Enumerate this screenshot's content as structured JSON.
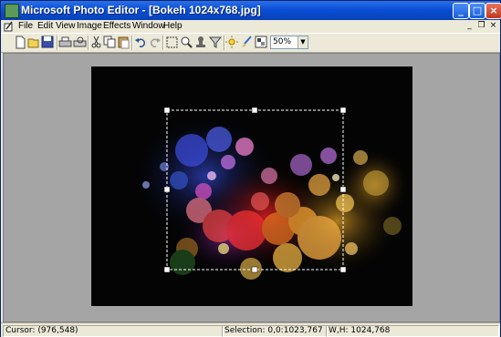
{
  "window": {
    "title": "Microsoft Photo Editor - [Bokeh 1024x768.jpg]"
  },
  "menu": [
    "File",
    "Edit",
    "View",
    "Image",
    "Effects",
    "Window",
    "Help"
  ],
  "toolbar": {
    "zoom_value": "50%"
  },
  "status": {
    "cursor": "Cursor: (976,548)",
    "selection": "Selection: 0,0:1023,767",
    "size": "W,H: 1024,768"
  },
  "icons": [
    "new-icon",
    "open-icon",
    "save-icon",
    "print-icon",
    "print-preview-icon",
    "cut-icon",
    "copy-icon",
    "paste-icon",
    "undo-icon",
    "redo-icon",
    "select-icon",
    "zoom-icon",
    "stamp-icon",
    "funnel-icon",
    "sun-icon",
    "brush-icon",
    "image-balance-icon"
  ]
}
